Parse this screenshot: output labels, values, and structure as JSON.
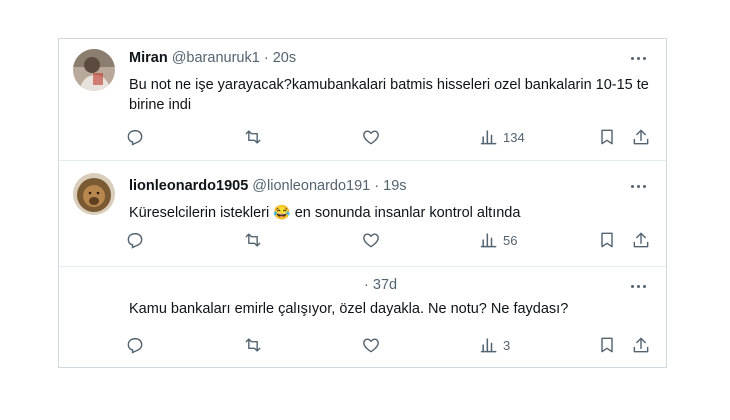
{
  "tweets": [
    {
      "name": "Miran",
      "handle": "@baranuruk1",
      "dot": "·",
      "time": "20s",
      "text": "Bu not ne işe yarayacak?kamubankalari batmis hisseleri ozel bankalarin 10-15 te birine indi",
      "views": "134"
    },
    {
      "name": "lionleonardo1905",
      "handle": "@lionleonardo191",
      "dot": "·",
      "time": "19s",
      "text_before": "Küreselcilerin istekleri",
      "emoji": "😂",
      "text_after": "en sonunda insanlar kontrol altında",
      "views": "56"
    },
    {
      "name": "",
      "handle": "",
      "dot": "·",
      "time": "37d",
      "text": "Kamu bankaları emirle çalışıyor, özel dayakla. Ne notu? Ne faydası?",
      "views": "3"
    }
  ],
  "colors": {
    "muted": "#536471",
    "border": "#cfd9de",
    "text": "#0f1419"
  },
  "icons": [
    "more-icon",
    "reply-icon",
    "retweet-icon",
    "like-icon",
    "views-icon",
    "bookmark-icon",
    "share-icon"
  ]
}
